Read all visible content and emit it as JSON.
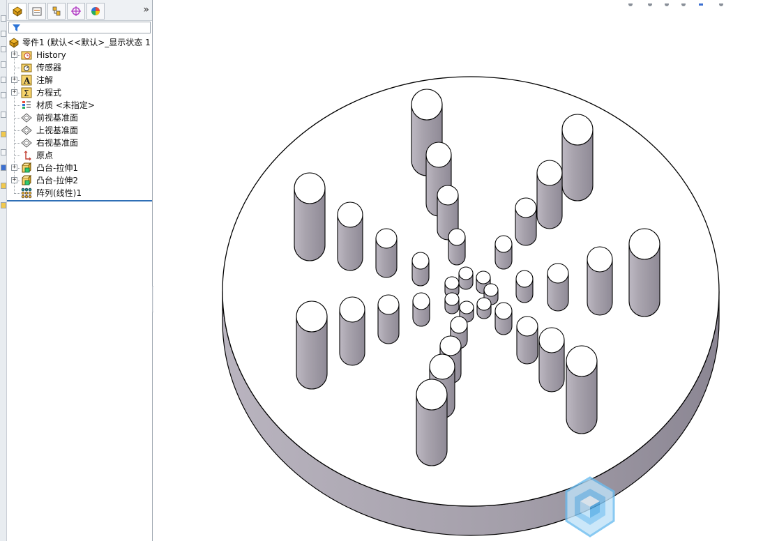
{
  "feature_manager": {
    "tabs": [
      {
        "name": "featuremanager-tab",
        "active": true
      },
      {
        "name": "propertymanager-tab",
        "active": false
      },
      {
        "name": "configurationmanager-tab",
        "active": false
      },
      {
        "name": "dimxpert-tab",
        "active": false
      },
      {
        "name": "display-manager-tab",
        "active": false
      }
    ],
    "more_label": "»",
    "filter_placeholder": "",
    "tree": [
      {
        "label": "零件1  (默认<<默认>_显示状态 1",
        "icon": "part-icon",
        "expander": false
      },
      {
        "label": "History",
        "icon": "history-icon",
        "expander": true
      },
      {
        "label": "传感器",
        "icon": "sensor-icon",
        "expander": false
      },
      {
        "label": "注解",
        "icon": "annotation-icon",
        "expander": true
      },
      {
        "label": "方程式",
        "icon": "equation-icon",
        "expander": true
      },
      {
        "label": "材质 <未指定>",
        "icon": "material-icon",
        "expander": false
      },
      {
        "label": "前视基准面",
        "icon": "plane-icon",
        "expander": false
      },
      {
        "label": "上视基准面",
        "icon": "plane-icon",
        "expander": false
      },
      {
        "label": "右视基准面",
        "icon": "plane-icon",
        "expander": false
      },
      {
        "label": "原点",
        "icon": "origin-icon",
        "expander": false
      },
      {
        "label": "凸台-拉伸1",
        "icon": "boss-extrude-icon",
        "expander": true
      },
      {
        "label": "凸台-拉伸2",
        "icon": "boss-extrude-icon",
        "expander": true
      },
      {
        "label": "阵列(线性)1",
        "icon": "linear-pattern-icon",
        "expander": false
      }
    ]
  },
  "colors": {
    "panel_bg": "#ffffff",
    "tab_bar": "#eef1f4",
    "rollback_bar": "#2f6fb6",
    "disk_face": "#ffffff",
    "disk_edge": "#9c97a2",
    "pin_side": "#a8a3ad",
    "pin_top": "#ffffff",
    "watermark": "#4aa8e6"
  }
}
